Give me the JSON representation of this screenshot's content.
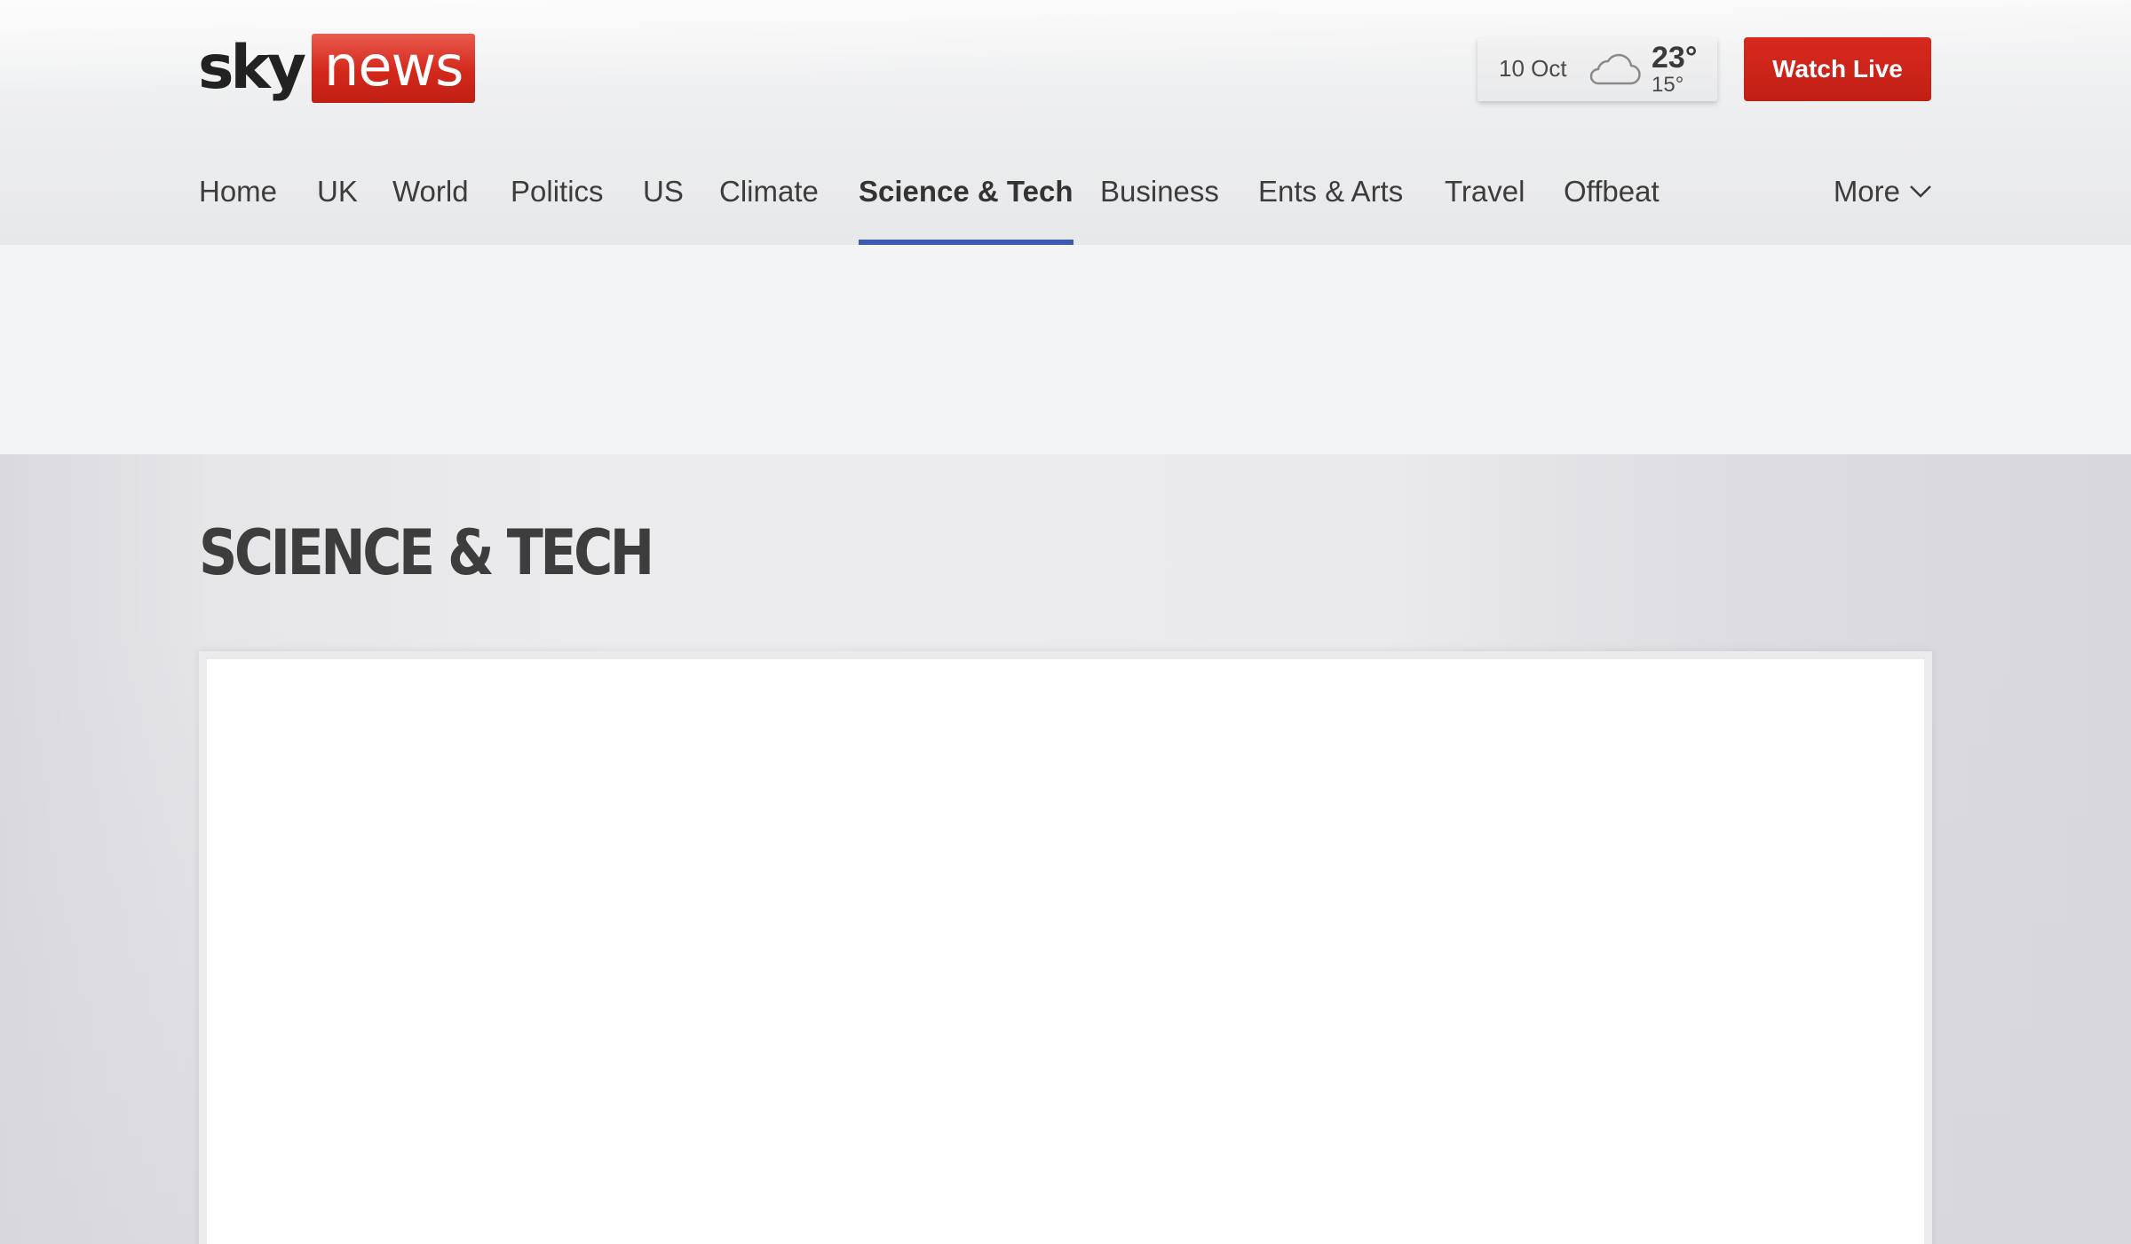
{
  "logo": {
    "sky": "sky",
    "news": "news"
  },
  "weather": {
    "date": "10 Oct",
    "icon": "cloud-icon",
    "high": "23°",
    "low": "15°"
  },
  "header": {
    "watch_live_label": "Watch Live"
  },
  "nav": {
    "items": [
      {
        "label": "Home"
      },
      {
        "label": "UK"
      },
      {
        "label": "World"
      },
      {
        "label": "Politics"
      },
      {
        "label": "US"
      },
      {
        "label": "Climate"
      },
      {
        "label": "Science & Tech",
        "active": true
      },
      {
        "label": "Business"
      },
      {
        "label": "Ents & Arts"
      },
      {
        "label": "Travel"
      },
      {
        "label": "Offbeat"
      }
    ],
    "more_label": "More"
  },
  "section": {
    "title": "SCIENCE & TECH"
  },
  "colors": {
    "brand_red": "#c8221a",
    "active_underline": "#3a5bb0",
    "text": "#3c3c3c"
  }
}
